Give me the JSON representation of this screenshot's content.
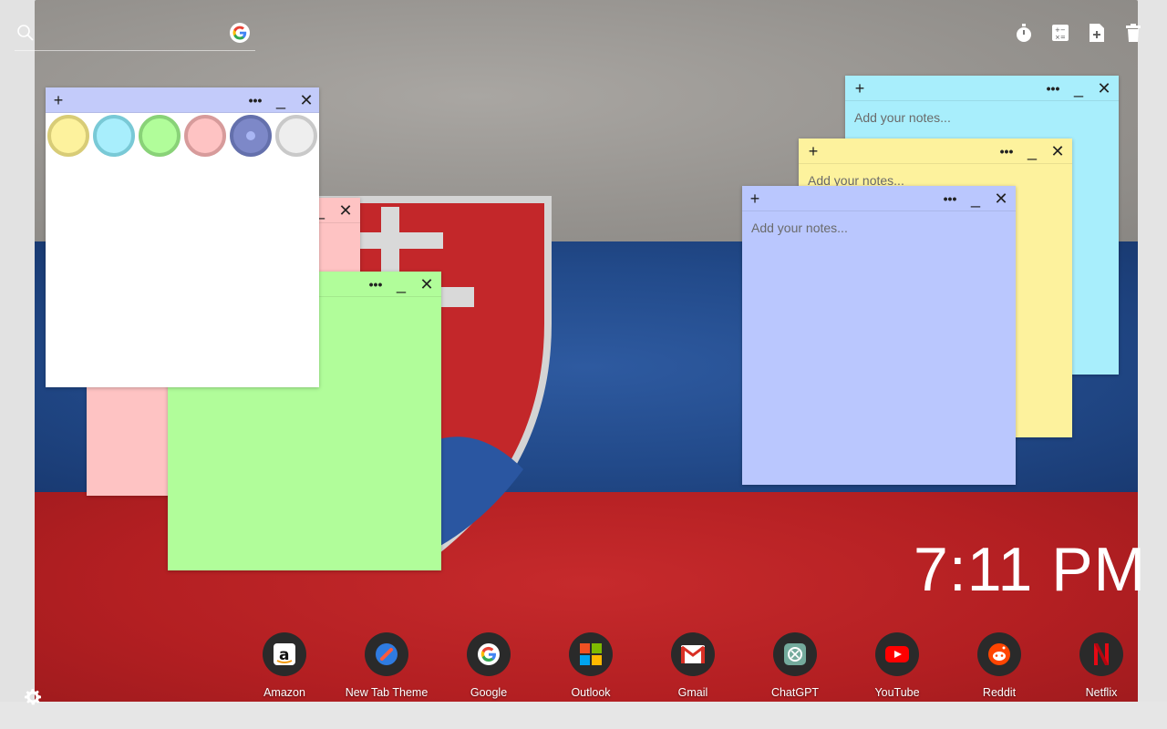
{
  "search": {
    "placeholder": ""
  },
  "notes": {
    "placeholder": "Add your notes..."
  },
  "colors": {
    "white_bar": "#c3cbfa",
    "pink": "#fec3c3",
    "green": "#b1fd9a",
    "cyan": "#a8eefc",
    "yellow": "#fdf29d",
    "lavender": "#bac7fe"
  },
  "swatches": [
    {
      "name": "yellow",
      "fill": "#fdf29d",
      "border": "#d8cc77"
    },
    {
      "name": "cyan",
      "fill": "#a8eefc",
      "border": "#79c9d6"
    },
    {
      "name": "green",
      "fill": "#b1fd9a",
      "border": "#89d278"
    },
    {
      "name": "pink",
      "fill": "#fec3c3",
      "border": "#d79b9b"
    },
    {
      "name": "lavender",
      "fill": "#7d88c8",
      "border": "#6470ac"
    },
    {
      "name": "white",
      "fill": "#eeeeee",
      "border": "#c9c9c9"
    }
  ],
  "clock": {
    "time": "7:11 PM"
  },
  "dock": [
    {
      "label": "Amazon",
      "icon": "amazon-icon"
    },
    {
      "label": "New Tab Theme",
      "icon": "new-tab-theme-icon"
    },
    {
      "label": "Google",
      "icon": "google-icon"
    },
    {
      "label": "Outlook",
      "icon": "outlook-icon"
    },
    {
      "label": "Gmail",
      "icon": "gmail-icon"
    },
    {
      "label": "ChatGPT",
      "icon": "chatgpt-icon"
    },
    {
      "label": "YouTube",
      "icon": "youtube-icon"
    },
    {
      "label": "Reddit",
      "icon": "reddit-icon"
    },
    {
      "label": "Netflix",
      "icon": "netflix-icon"
    }
  ],
  "toolbar_icons": [
    "stopwatch-icon",
    "calculator-icon",
    "add-note-icon",
    "trash-icon"
  ]
}
